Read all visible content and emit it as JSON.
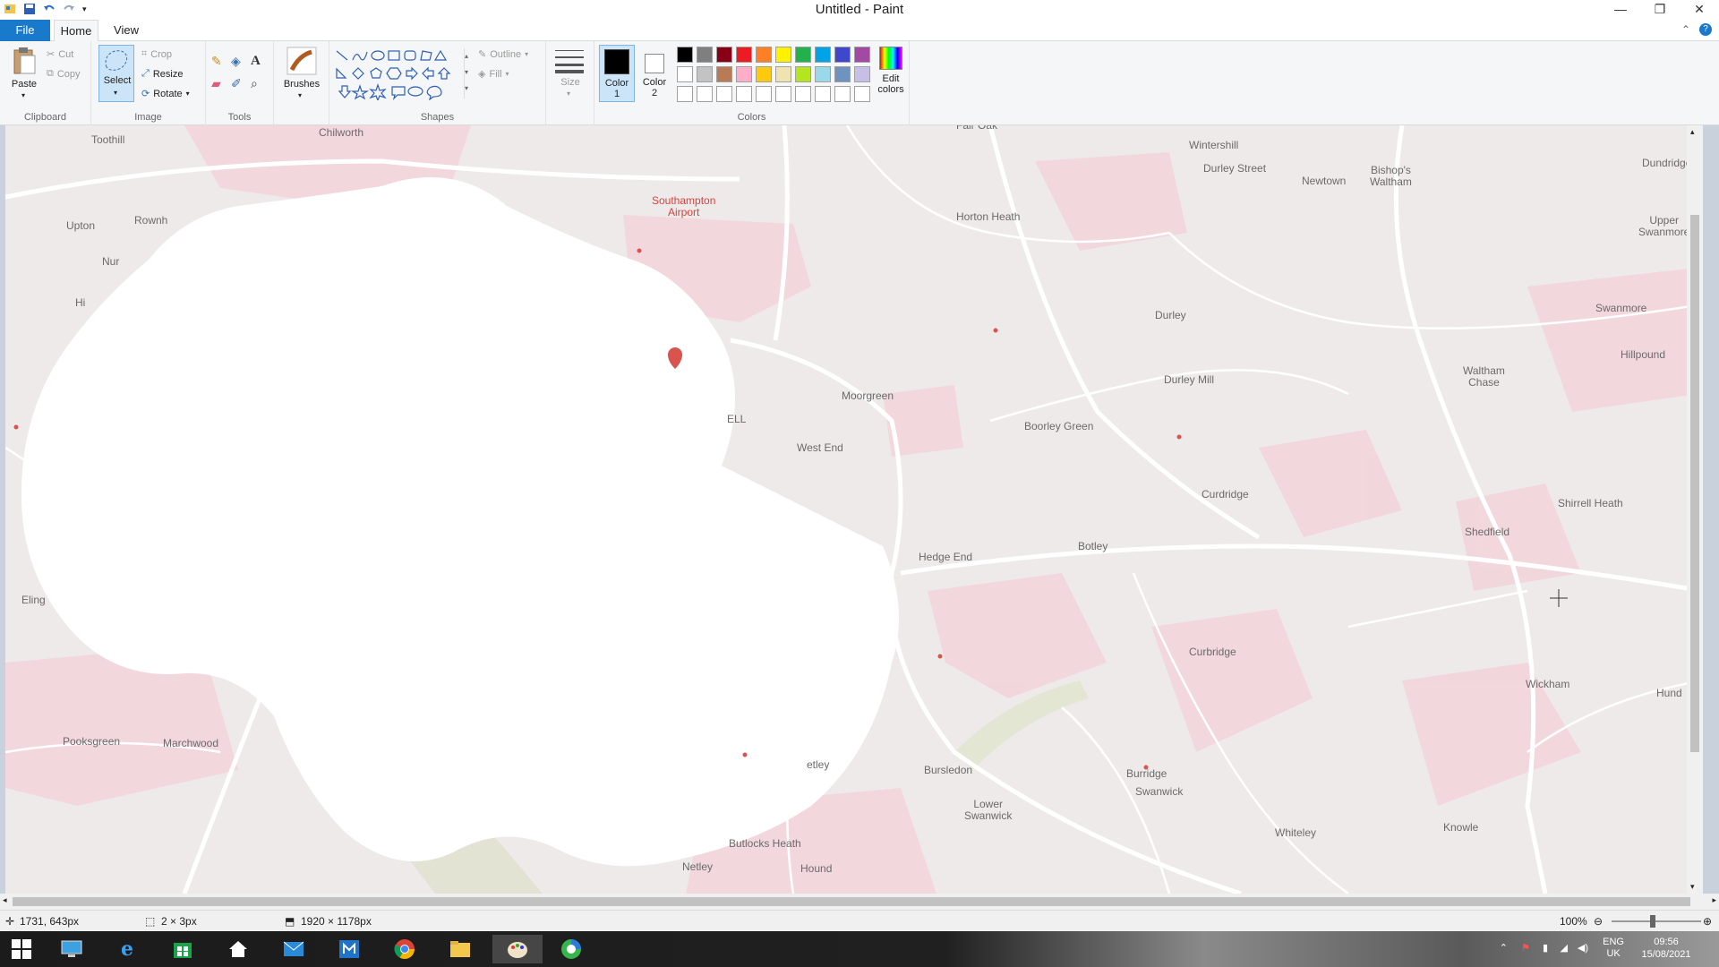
{
  "window": {
    "title": "Untitled - Paint",
    "controls": [
      "minimize",
      "restore",
      "close"
    ]
  },
  "menu_tabs": [
    {
      "label": "File",
      "active": false
    },
    {
      "label": "Home",
      "active": true
    },
    {
      "label": "View",
      "active": false
    }
  ],
  "ribbon": {
    "clipboard": {
      "group_label": "Clipboard",
      "paste": "Paste",
      "cut": "Cut",
      "copy": "Copy"
    },
    "image": {
      "group_label": "Image",
      "select": "Select",
      "crop": "Crop",
      "resize": "Resize",
      "rotate": "Rotate"
    },
    "tools": {
      "group_label": "Tools",
      "items": [
        "pencil-icon",
        "fill-icon",
        "text-icon",
        "eraser-icon",
        "color-picker-icon",
        "magnifier-icon"
      ]
    },
    "brushes": {
      "label": "Brushes"
    },
    "shapes": {
      "group_label": "Shapes",
      "outline": "Outline",
      "fill": "Fill"
    },
    "size": {
      "label": "Size"
    },
    "colors": {
      "group_label": "Colors",
      "color1_label": "Color\n1",
      "color2_label": "Color\n2",
      "color1": "#000000",
      "color2": "#ffffff",
      "edit_colors": "Edit\ncolors",
      "palette_row1": [
        "#000000",
        "#7f7f7f",
        "#880015",
        "#ed1c24",
        "#ff7f27",
        "#fff200",
        "#22b14c",
        "#00a2e8",
        "#3f48cc",
        "#a349a4"
      ],
      "palette_row2": [
        "#ffffff",
        "#c3c3c3",
        "#b97a57",
        "#ffaec9",
        "#ffc90e",
        "#efe4b0",
        "#b5e61d",
        "#99d9ea",
        "#7092be",
        "#c8bfe7"
      ],
      "palette_row3": [
        "#ffffff",
        "#ffffff",
        "#ffffff",
        "#ffffff",
        "#ffffff",
        "#ffffff",
        "#ffffff",
        "#ffffff",
        "#ffffff",
        "#ffffff"
      ]
    }
  },
  "map": {
    "airport": "Southampton\nAirport",
    "places": [
      "Toothill",
      "Chilworth",
      "Fair Oak",
      "Wintershill",
      "Durley Street",
      "Newtown",
      "Bishop's\nWaltham",
      "Dundridge",
      "Upton",
      "Rownh",
      "Nur",
      "Hi",
      "Horton Heath",
      "Upper\nSwanmore",
      "Durley",
      "Swanmore",
      "Durley Mill",
      "Hillpound",
      "Waltham\nChase",
      "Moorgreen",
      "ELL",
      "West End",
      "Boorley Green",
      "Curdridge",
      "Shirrell Heath",
      "Shedfield",
      "Botley",
      "Hedge End",
      "Eling",
      "Curbridge",
      "Wickham",
      "Hund",
      "Pooksgreen",
      "Marchwood",
      "etley",
      "Bursledon",
      "Burridge",
      "Swanwick",
      "Lower\nSwanwick",
      "Whiteley",
      "Knowle",
      "Butlocks Heath",
      "Netley",
      "Hound"
    ]
  },
  "statusbar": {
    "cursor_position": "1731, 643px",
    "selection_size": "2 × 3px",
    "canvas_size": "1920 × 1178px",
    "zoom": "100%"
  },
  "taskbar": {
    "apps": [
      "start-icon",
      "this-pc-icon",
      "internet-explorer-icon",
      "store-icon",
      "home-icon",
      "mail-icon",
      "remote-desktop-icon",
      "chrome-icon",
      "file-explorer-icon",
      "paint-icon",
      "edge-icon"
    ],
    "language": "ENG\nUK",
    "time": "09:56",
    "date": "15/08/2021"
  }
}
